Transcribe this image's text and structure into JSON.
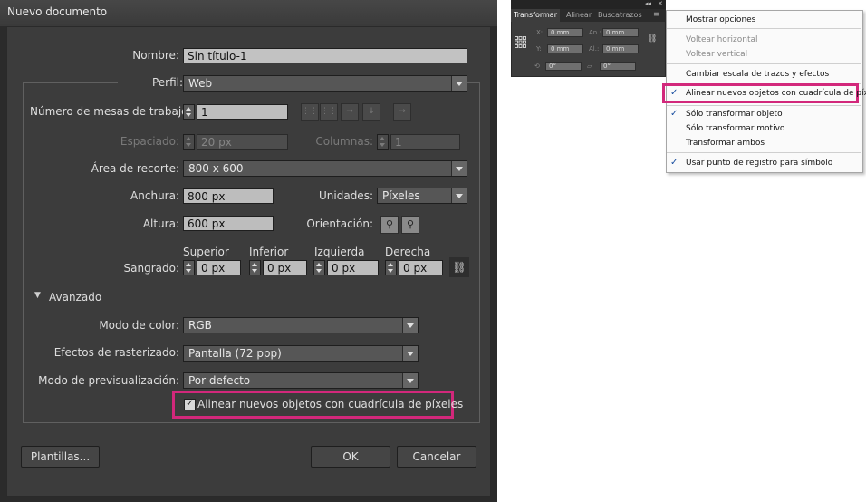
{
  "dialog": {
    "title": "Nuevo documento",
    "name": {
      "label": "Nombre:",
      "value": "Sin título-1"
    },
    "profile": {
      "label": "Perfil:",
      "value": "Web"
    },
    "artboards": {
      "label": "Número de mesas de trabajo:",
      "value": "1"
    },
    "spacing": {
      "label": "Espaciado:",
      "value": "20 px"
    },
    "columns": {
      "label": "Columnas:",
      "value": "1"
    },
    "crop_area": {
      "label": "Área de recorte:",
      "value": "800 x 600"
    },
    "width": {
      "label": "Anchura:",
      "value": "800 px"
    },
    "units": {
      "label": "Unidades:",
      "value": "Píxeles"
    },
    "height": {
      "label": "Altura:",
      "value": "600 px"
    },
    "orientation": {
      "label": "Orientación:"
    },
    "bleed": {
      "label": "Sangrado:",
      "top": {
        "label": "Superior",
        "value": "0 px"
      },
      "bottom": {
        "label": "Inferior",
        "value": "0 px"
      },
      "left": {
        "label": "Izquierda",
        "value": "0 px"
      },
      "right": {
        "label": "Derecha",
        "value": "0 px"
      }
    },
    "advanced": {
      "label": "Avanzado",
      "color_mode": {
        "label": "Modo de color:",
        "value": "RGB"
      },
      "raster_effects": {
        "label": "Efectos de rasterizado:",
        "value": "Pantalla (72 ppp)"
      },
      "preview_mode": {
        "label": "Modo de previsualización:",
        "value": "Por defecto"
      },
      "align_pixel_grid": {
        "label": "Alinear nuevos objetos con cuadrícula de píxeles",
        "checked": true
      }
    },
    "buttons": {
      "templates": "Plantillas...",
      "ok": "OK",
      "cancel": "Cancelar"
    }
  },
  "panel": {
    "tabs": [
      "Transformar",
      "Alinear",
      "Buscatrazos"
    ],
    "fields": {
      "x": {
        "label": "X:",
        "value": "0 mm"
      },
      "y": {
        "label": "Y:",
        "value": "0 mm"
      },
      "w": {
        "label": "An.:",
        "value": "0 mm"
      },
      "h": {
        "label": "Al.:",
        "value": "0 mm"
      },
      "rotate": {
        "value": "0°"
      },
      "shear": {
        "value": "0°"
      }
    }
  },
  "menu": {
    "items": [
      {
        "label": "Mostrar opciones",
        "enabled": true,
        "checked": false
      },
      {
        "label": "Voltear horizontal",
        "enabled": false,
        "checked": false
      },
      {
        "label": "Voltear vertical",
        "enabled": false,
        "checked": false
      },
      {
        "label": "Cambiar escala de trazos y efectos",
        "enabled": true,
        "checked": false
      },
      {
        "label": "Alinear nuevos objetos con cuadrícula de píxeles",
        "enabled": true,
        "checked": true
      },
      {
        "label": "Sólo transformar objeto",
        "enabled": true,
        "checked": true
      },
      {
        "label": "Sólo transformar motivo",
        "enabled": true,
        "checked": false
      },
      {
        "label": "Transformar ambos",
        "enabled": true,
        "checked": false
      },
      {
        "label": "Usar punto de registro para símbolo",
        "enabled": true,
        "checked": true
      }
    ]
  },
  "colors": {
    "highlight": "#d2287b",
    "dialog_bg": "#3c3c3c",
    "check": "#1a4fa0"
  }
}
